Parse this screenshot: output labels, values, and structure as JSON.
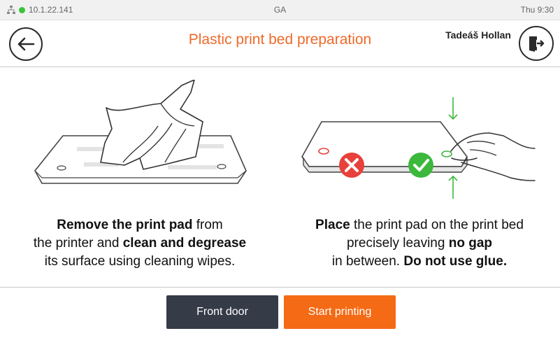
{
  "status_bar": {
    "ip_address": "10.1.22.141",
    "center_text": "GA",
    "clock": "Thu 9:30",
    "connection_color": "#3cc33c"
  },
  "header": {
    "title": "Plastic print bed preparation",
    "user_name": "Tadeáš Hollan"
  },
  "steps": [
    {
      "line1_bold": "Remove the print pad",
      "line1_rest": " from",
      "line2_pre": "the printer and ",
      "line2_bold": "clean and degrease",
      "line3": "its surface using cleaning wipes."
    },
    {
      "line1_bold": "Place",
      "line1_rest": " the print pad on the print bed",
      "line2_pre": "precisely leaving ",
      "line2_bold": "no gap",
      "line3_pre": "in between. ",
      "line3_bold": "Do not use glue."
    }
  ],
  "buttons": {
    "front_door": "Front door",
    "start_printing": "Start printing"
  },
  "colors": {
    "accent": "#ee6a2a",
    "start_button": "#f56a14",
    "dark_button": "#353c48",
    "error_mark": "#e8403a",
    "ok_mark": "#3cb83c"
  }
}
